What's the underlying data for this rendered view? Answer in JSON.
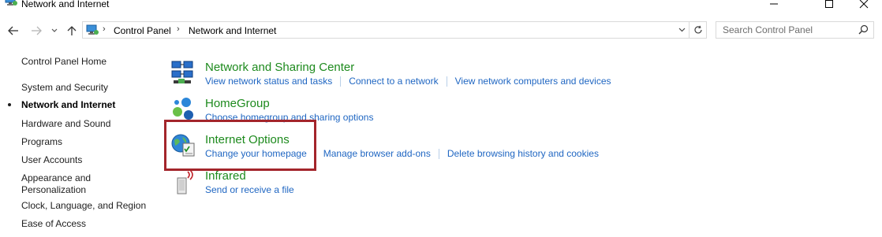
{
  "window": {
    "title": "Network and Internet",
    "controls": [
      "minimize-icon",
      "maximize-icon",
      "close-icon"
    ]
  },
  "navigation": {
    "breadcrumbs": [
      "Control Panel",
      "Network and Internet"
    ],
    "search_placeholder": "Search Control Panel"
  },
  "sidebar": {
    "items": [
      {
        "label": "Control Panel Home"
      },
      {
        "label": "System and Security"
      },
      {
        "label": "Network and Internet",
        "active": true
      },
      {
        "label": "Hardware and Sound"
      },
      {
        "label": "Programs"
      },
      {
        "label": "User Accounts"
      },
      {
        "label": "Appearance and Personalization"
      },
      {
        "label": "Clock, Language, and Region"
      },
      {
        "label": "Ease of Access"
      }
    ]
  },
  "categories": [
    {
      "title": "Network and Sharing Center",
      "icon": "network-sharing-icon",
      "links": [
        "View network status and tasks",
        "Connect to a network",
        "View network computers and devices"
      ]
    },
    {
      "title": "HomeGroup",
      "icon": "homegroup-icon",
      "links": [
        "Choose homegroup and sharing options"
      ]
    },
    {
      "title": "Internet Options",
      "icon": "internet-options-icon",
      "links": [
        "Change your homepage",
        "Manage browser add-ons",
        "Delete browsing history and cookies"
      ],
      "highlighted": true
    },
    {
      "title": "Infrared",
      "icon": "infrared-icon",
      "links": [
        "Send or receive a file"
      ]
    }
  ],
  "colors": {
    "category_title": "#1d8a1d",
    "link": "#1f66c2",
    "highlight_border": "#a3252b"
  }
}
